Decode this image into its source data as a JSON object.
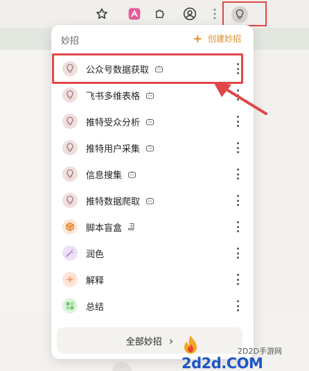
{
  "toolbar": {
    "icons": [
      "star-icon",
      "extension-icon",
      "puzzle-icon",
      "profile-icon",
      "more-dots-icon",
      "bulb-icon"
    ]
  },
  "popup": {
    "title": "妙招",
    "create_label": "创建妙招",
    "items": [
      {
        "label": "公众号数据获取",
        "icon": "bulb-icon",
        "badge": "robot-icon"
      },
      {
        "label": "飞书多维表格",
        "icon": "bulb-icon",
        "badge": "robot-icon"
      },
      {
        "label": "推特受众分析",
        "icon": "bulb-icon",
        "badge": "robot-icon"
      },
      {
        "label": "推特用户采集",
        "icon": "bulb-icon",
        "badge": "robot-icon"
      },
      {
        "label": "信息搜集",
        "icon": "bulb-icon",
        "badge": "robot-icon"
      },
      {
        "label": "推特数据爬取",
        "icon": "bulb-icon",
        "badge": "robot-icon"
      },
      {
        "label": "脚本盲盒",
        "icon": "box-icon",
        "badge": "script-icon"
      },
      {
        "label": "润色",
        "icon": "wand-icon",
        "badge": ""
      },
      {
        "label": "解释",
        "icon": "sparkle-icon",
        "badge": ""
      },
      {
        "label": "总结",
        "icon": "grid-icon",
        "badge": ""
      }
    ],
    "all_label": "全部妙招",
    "all_chevron": "›"
  },
  "colors": {
    "accent": "#e08a1e",
    "highlight": "#e0474a"
  },
  "watermark": {
    "site": "2D2D手游网",
    "logo": "2d2d.COM"
  }
}
